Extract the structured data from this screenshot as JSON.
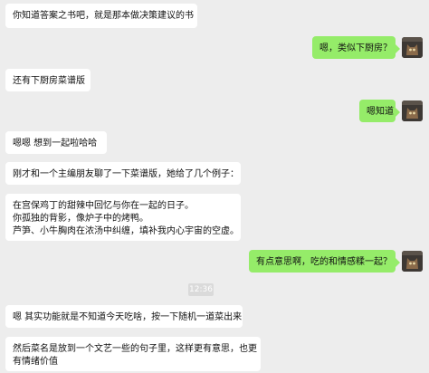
{
  "messages": [
    {
      "side": "left",
      "lines": [
        "你知道答案之书吧，就是那本做决策建议的书"
      ]
    },
    {
      "side": "right",
      "lines": [
        "嗯，类似下厨房？"
      ]
    },
    {
      "side": "left",
      "lines": [
        "还有下厨房菜谱版"
      ]
    },
    {
      "side": "right",
      "lines": [
        "嗯知道"
      ]
    },
    {
      "side": "left",
      "lines": [
        "嗯嗯  想到一起啦哈哈"
      ]
    },
    {
      "side": "left",
      "lines": [
        "刚才和一个主编朋友聊了一下菜谱版，她给了几个例子："
      ]
    },
    {
      "side": "left",
      "lines": [
        "在宫保鸡丁的甜辣中回忆与你在一起的日子。",
        "你孤独的背影，像炉子中的烤鸭。",
        "芦笋、小牛胸肉在浓汤中纠缠，填补我内心宇宙的空虚。"
      ]
    },
    {
      "side": "right",
      "lines": [
        "有点意思啊，吃的和情感糅一起？"
      ]
    },
    {
      "side": "left",
      "lines": [
        "嗯 其实功能就是不知道今天吃啥，按一下随机一道菜出来"
      ]
    },
    {
      "side": "left",
      "lines": [
        "然后菜名是放到一个文艺一些的句子里，这样更有意思，也更",
        "有情绪价值"
      ]
    }
  ],
  "timestamp": "12:36",
  "colors": {
    "background": "#ededed",
    "left_bubble": "#ffffff",
    "right_bubble": "#95ec69",
    "timestamp_bg": "#dadada"
  },
  "icons": {
    "avatar": "avatar-cat-photo"
  }
}
